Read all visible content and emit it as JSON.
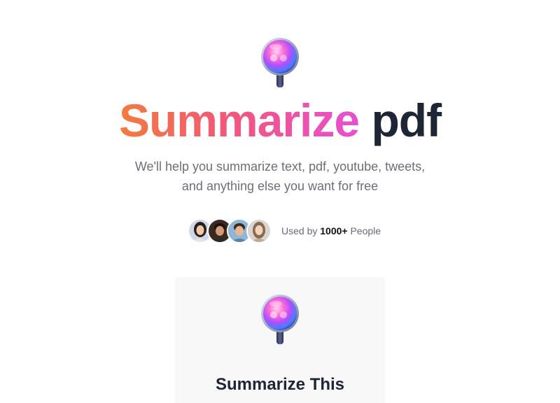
{
  "hero": {
    "title_gradient": "Summarize",
    "title_dark": "pdf",
    "subtitle_line1": "We'll help you summarize text, pdf, youtube, tweets,",
    "subtitle_line2": "and anything else you want for free"
  },
  "social_proof": {
    "prefix": "Used by",
    "count": "1000+",
    "suffix": "People",
    "avatars": [
      "avatar-1",
      "avatar-2",
      "avatar-3",
      "avatar-4"
    ]
  },
  "card": {
    "title": "Summarize This"
  },
  "colors": {
    "gradient_start": "#f47b3c",
    "gradient_mid": "#f0587a",
    "gradient_end": "#e84fd2",
    "dark_text": "#1e2535",
    "muted_text": "#6b6f78",
    "card_bg": "#f8f8f8"
  },
  "icons": {
    "logo": "magnifier-orb-icon"
  }
}
